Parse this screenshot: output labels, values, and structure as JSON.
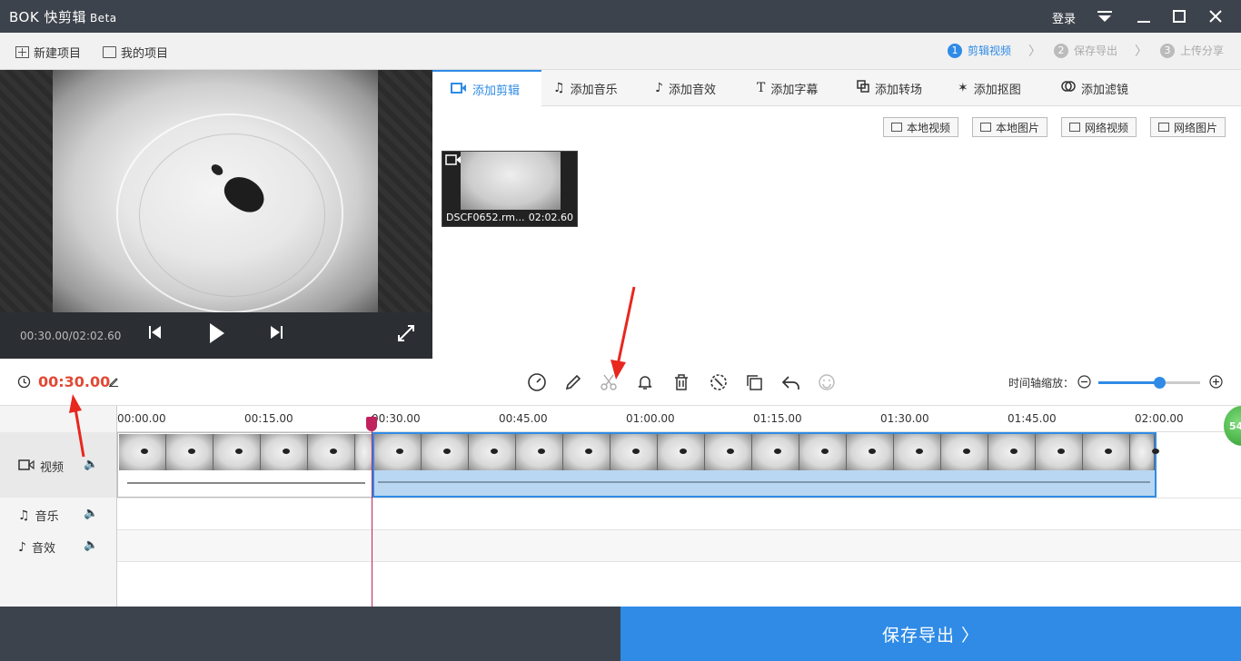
{
  "app": {
    "logo": "BOK 快剪辑",
    "beta": "Beta",
    "login": "登录"
  },
  "toolbar": {
    "new_project": "新建项目",
    "my_projects": "我的项目",
    "steps": [
      {
        "num": "1",
        "label": "剪辑视频"
      },
      {
        "num": "2",
        "label": "保存导出"
      },
      {
        "num": "3",
        "label": "上传分享"
      }
    ]
  },
  "preview": {
    "time": "00:30.00/02:02.60"
  },
  "tabs": [
    {
      "label": "添加剪辑"
    },
    {
      "label": "添加音乐"
    },
    {
      "label": "添加音效"
    },
    {
      "label": "添加字幕"
    },
    {
      "label": "添加转场"
    },
    {
      "label": "添加抠图"
    },
    {
      "label": "添加滤镜"
    }
  ],
  "sources": [
    "本地视频",
    "本地图片",
    "网络视频",
    "网络图片"
  ],
  "media": {
    "name": "DSCF0652.rm...",
    "duration": "02:02.60"
  },
  "editbar": {
    "current_time": "00:30.00",
    "zoom_label": "时间轴缩放：",
    "zoom_level": 0.6
  },
  "ruler": [
    "00:00.00",
    "00:15.00",
    "00:30.00",
    "00:45.00",
    "01:00.00",
    "01:15.00",
    "01:30.00",
    "01:45.00",
    "02:00.00"
  ],
  "tracks": {
    "video": "视频",
    "music": "音乐",
    "effects": "音效"
  },
  "bottom": {
    "save": "保存导出 〉"
  },
  "badge": "54"
}
